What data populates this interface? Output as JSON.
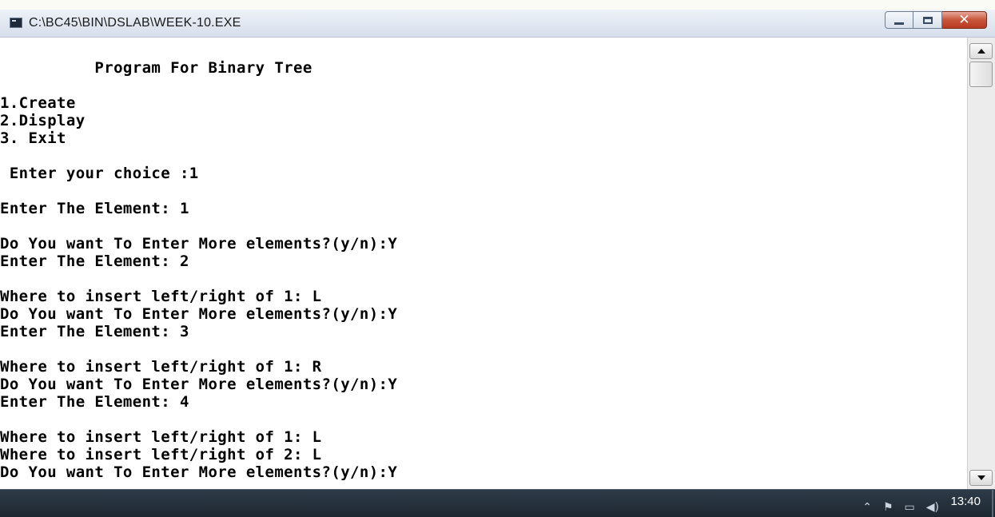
{
  "window": {
    "title": "C:\\BC45\\BIN\\DSLAB\\WEEK-10.EXE",
    "buttons": {
      "minimize": "minimize",
      "maximize": "maximize",
      "close": "✕"
    }
  },
  "console": {
    "lines": [
      "          Program For Binary Tree",
      "1.Create",
      "2.Display",
      "3. Exit",
      " Enter your choice :1",
      "Enter The Element: 1",
      "Do You want To Enter More elements?(y/n):Y",
      "Enter The Element: 2",
      "Where to insert left/right of 1: L",
      "Do You want To Enter More elements?(y/n):Y",
      "Enter The Element: 3",
      "Where to insert left/right of 1: R",
      "Do You want To Enter More elements?(y/n):Y",
      "Enter The Element: 4",
      "Where to insert left/right of 1: L",
      "Where to insert left/right of 2: L",
      "Do You want To Enter More elements?(y/n):Y"
    ]
  },
  "taskbar": {
    "clock": "13:40",
    "tray_icons": [
      "chevron-up-icon",
      "flag-icon",
      "network-icon",
      "volume-icon"
    ]
  }
}
